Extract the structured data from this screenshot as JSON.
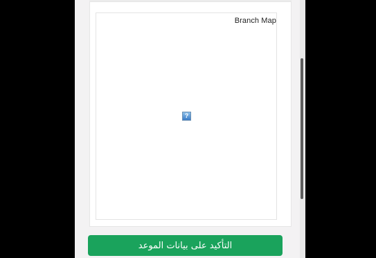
{
  "map": {
    "label": "Branch Map",
    "image_icon": "broken-image-icon",
    "image_glyph": "?"
  },
  "actions": {
    "confirm_label": "التأكيد على بيانات الموعد"
  },
  "colors": {
    "accent": "#1aa35c",
    "page_bg": "#f3f2f3",
    "frame_bg": "#000000"
  }
}
